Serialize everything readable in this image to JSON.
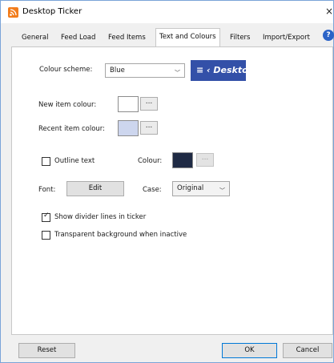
{
  "window": {
    "title": "Desktop Ticker",
    "close_glyph": "×",
    "app_icon": "rss-feed-icon"
  },
  "tabs": [
    {
      "label": "General"
    },
    {
      "label": "Feed Load"
    },
    {
      "label": "Feed Items"
    },
    {
      "label": "Text and Colours",
      "active": true
    },
    {
      "label": "Filters"
    },
    {
      "label": "Import/Export"
    }
  ],
  "help_glyph": "?",
  "colour_scheme": {
    "label": "Colour scheme:",
    "value": "Blue",
    "preview_text": "≡ ‹ Deskto",
    "preview_color": "#3350a8"
  },
  "new_item_colour": {
    "label": "New item colour:",
    "swatch": "#ffffff",
    "button": "..."
  },
  "recent_item_colour": {
    "label": "Recent item colour:",
    "swatch": "#cdd6ee",
    "button": "..."
  },
  "outline": {
    "checkbox_label": "Outline text",
    "checked": false,
    "colour_label": "Colour:",
    "swatch": "#1f2a44",
    "button": "..."
  },
  "font": {
    "label": "Font:",
    "button": "Edit"
  },
  "case": {
    "label": "Case:",
    "value": "Original"
  },
  "divider_lines": {
    "label": "Show divider lines in ticker",
    "checked": true
  },
  "transparent": {
    "label": "Transparent background when inactive",
    "checked": false
  },
  "footer": {
    "reset": "Reset",
    "ok": "OK",
    "cancel": "Cancel"
  }
}
